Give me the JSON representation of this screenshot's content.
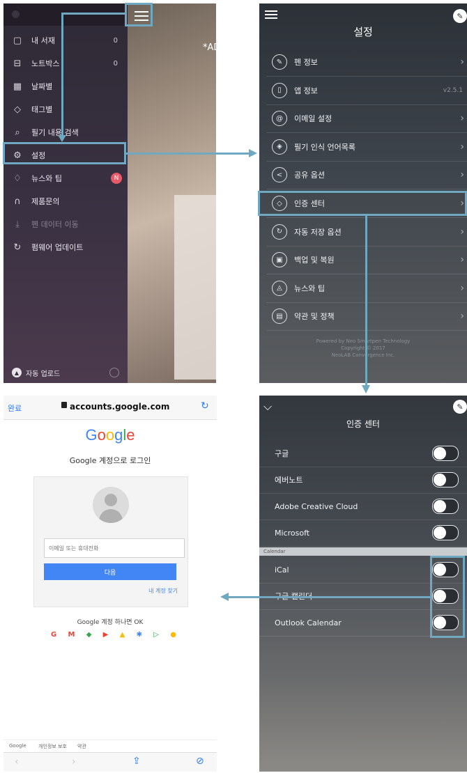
{
  "menu_panel": {
    "ad_text": "*AD",
    "items": [
      {
        "icon": "book-icon",
        "label": "내 서재",
        "count": "0"
      },
      {
        "icon": "inbox-icon",
        "label": "노트박스",
        "count": "0"
      },
      {
        "icon": "calendar-icon",
        "label": "날짜별",
        "count": ""
      },
      {
        "icon": "tag-icon",
        "label": "태그별",
        "count": ""
      },
      {
        "icon": "search-icon",
        "label": "필기 내용 검색",
        "count": ""
      },
      {
        "icon": "gear-icon",
        "label": "설정",
        "count": ""
      },
      {
        "icon": "bell-icon",
        "label": "뉴스와 팁",
        "count": "",
        "badge": "N"
      },
      {
        "icon": "headset-icon",
        "label": "제품문의",
        "count": ""
      },
      {
        "icon": "download-icon",
        "label": "펜 데이터 이동",
        "count": ""
      },
      {
        "icon": "refresh-icon",
        "label": "펌웨어 업데이트",
        "count": ""
      }
    ],
    "bottom_label": "자동 업로드"
  },
  "settings_panel": {
    "title": "설정",
    "items": [
      {
        "icon": "pen-icon",
        "glyph": "✎",
        "label": "펜 정보",
        "value": ""
      },
      {
        "icon": "phone-icon",
        "glyph": "▯",
        "label": "앱 정보",
        "value": "v2.5.1"
      },
      {
        "icon": "email-icon",
        "glyph": "@",
        "label": "이메일 설정",
        "value": ""
      },
      {
        "icon": "handwriting-icon",
        "glyph": "◈",
        "label": "필기 인식 언어목록",
        "value": ""
      },
      {
        "icon": "share-icon",
        "glyph": "<",
        "label": "공유 옵션",
        "value": ""
      },
      {
        "icon": "shield-icon",
        "glyph": "◇",
        "label": "인증 센터",
        "value": ""
      },
      {
        "icon": "autosave-icon",
        "glyph": "↻",
        "label": "자동 저장 옵션",
        "value": ""
      },
      {
        "icon": "backup-icon",
        "glyph": "▣",
        "label": "백업 및 복원",
        "value": ""
      },
      {
        "icon": "bell-icon",
        "glyph": "◬",
        "label": "뉴스와 팁",
        "value": ""
      },
      {
        "icon": "terms-icon",
        "glyph": "▤",
        "label": "약관 및 정책",
        "value": ""
      }
    ],
    "footer_line1": "Powered by Neo Smartpen Technology",
    "footer_line2": "Copyright © 2017",
    "footer_line3": "NeoLAB Convergence Inc."
  },
  "google_panel": {
    "done_label": "완료",
    "url": "accounts.google.com",
    "google_logo": "Google",
    "login_title": "Google 계정으로 로그인",
    "email_placeholder": "이메일 또는 휴대전화",
    "next_label": "다음",
    "find_account": "내 계정 찾기",
    "one_account": "Google 계정 하나면 OK",
    "footer_google": "Google",
    "footer_privacy": "개인정보 보호",
    "footer_terms": "약관"
  },
  "auth_panel": {
    "title": "인증 센터",
    "accounts": [
      {
        "label": "구글",
        "on": false
      },
      {
        "label": "에버노트",
        "on": false
      },
      {
        "label": "Adobe Creative Cloud",
        "on": false
      },
      {
        "label": "Microsoft",
        "on": false
      }
    ],
    "section_label": "Calendar",
    "calendars": [
      {
        "label": "iCal",
        "on": false
      },
      {
        "label": "구글 캘린더",
        "on": false
      },
      {
        "label": "Outlook Calendar",
        "on": false
      }
    ]
  },
  "colors": {
    "highlight": "#6fa8c0",
    "google_blue": "#4285f4",
    "badge": "#e85a6a"
  }
}
